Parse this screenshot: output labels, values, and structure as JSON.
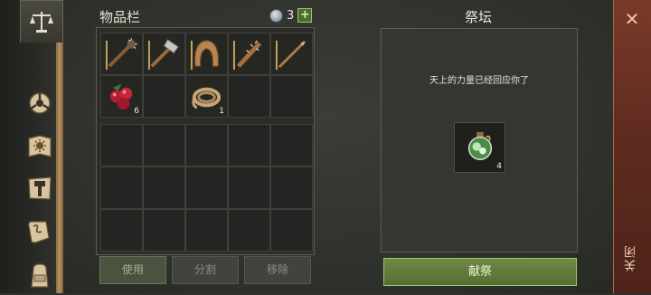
{
  "inventory": {
    "title": "物品栏",
    "currency_count": "3",
    "currency_add": "+",
    "items": [
      {
        "icon": "spiked-club-icon",
        "qty": ""
      },
      {
        "icon": "stone-hammer-icon",
        "qty": ""
      },
      {
        "icon": "leather-hood-icon",
        "qty": ""
      },
      {
        "icon": "spiked-bat-icon",
        "qty": ""
      },
      {
        "icon": "wooden-spear-icon",
        "qty": ""
      },
      {
        "icon": "berries-icon",
        "qty": "6"
      },
      {
        "icon": "empty",
        "qty": ""
      },
      {
        "icon": "rope-icon",
        "qty": "1"
      }
    ],
    "buttons": {
      "use": "使用",
      "split": "分割",
      "remove": "移除"
    }
  },
  "altar": {
    "title": "祭坛",
    "message": "天上的力量已经回应你了",
    "slot": {
      "icon": "green-potion-icon",
      "qty": "4"
    },
    "offer_label": "献祭"
  },
  "close": {
    "label": "关闭",
    "icon": "close-icon"
  },
  "sidebar": [
    "scales-icon",
    "triskelion-icon",
    "sun-book-icon",
    "hammer-map-icon",
    "scroll-icon",
    "backpack-icon"
  ]
}
